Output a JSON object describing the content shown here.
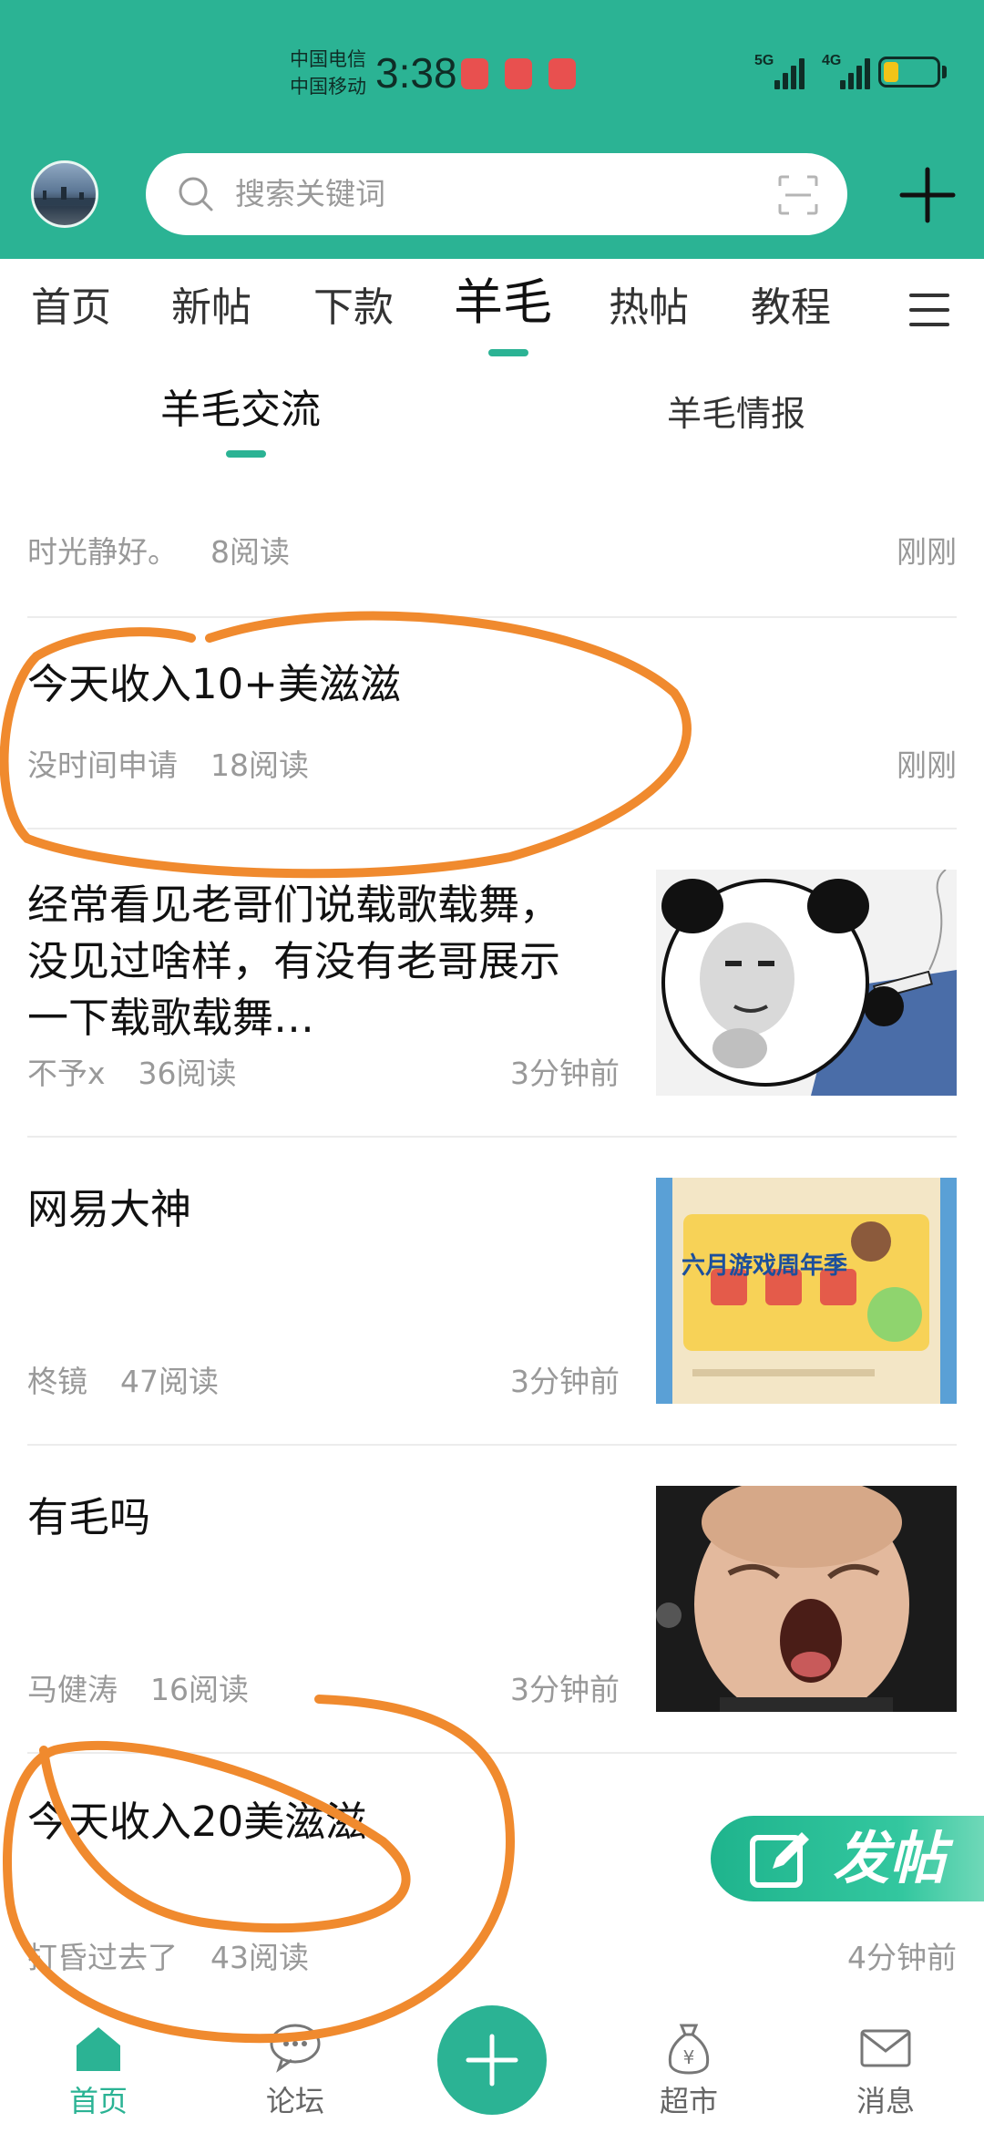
{
  "status_bar": {
    "carrier1": "中国电信",
    "carrier2": "中国移动",
    "time": "3:38",
    "net1": "5G",
    "net2": "4G"
  },
  "header": {
    "search_placeholder": "搜索关键词"
  },
  "tabs": [
    {
      "label": "首页"
    },
    {
      "label": "新帖"
    },
    {
      "label": "下款"
    },
    {
      "label": "羊毛",
      "active": true
    },
    {
      "label": "热帖"
    },
    {
      "label": "教程"
    }
  ],
  "subtabs": [
    {
      "label": "羊毛交流",
      "active": true
    },
    {
      "label": "羊毛情报"
    }
  ],
  "posts": [
    {
      "title": "",
      "author": "时光静好。",
      "reads": "8阅读",
      "time": "刚刚"
    },
    {
      "title": "今天收入10+美滋滋",
      "author": "没时间申请",
      "reads": "18阅读",
      "time": "刚刚"
    },
    {
      "title_line1": "经常看见老哥们说载歌载舞，",
      "title_line2": "没见过啥样，有没有老哥展示",
      "title_line3": "一下载歌载舞…",
      "author": "不予x",
      "reads": "36阅读",
      "time": "3分钟前",
      "thumb": "panda-meme-thumbnail"
    },
    {
      "title": "网易大神",
      "author": "柊镜",
      "reads": "47阅读",
      "time": "3分钟前",
      "thumb": "game-anniversary-thumbnail",
      "thumb_text": "六月游戏周年季"
    },
    {
      "title": "有毛吗",
      "author": "马健涛",
      "reads": "16阅读",
      "time": "3分钟前",
      "thumb": "screaming-man-thumbnail"
    },
    {
      "title": "今天收入20美滋滋",
      "author": "打昏过去了",
      "reads": "43阅读",
      "time": "4分钟前"
    }
  ],
  "fab": {
    "label": "发帖"
  },
  "bottom_nav": [
    {
      "label": "首页",
      "icon": "home-icon",
      "active": true
    },
    {
      "label": "论坛",
      "icon": "chat-bubble-icon"
    },
    {
      "label": "",
      "icon": "plus-icon"
    },
    {
      "label": "超市",
      "icon": "money-bag-icon"
    },
    {
      "label": "消息",
      "icon": "envelope-icon"
    }
  ],
  "colors": {
    "accent": "#2bb394",
    "annotation": "#f08a2e",
    "meta_text": "#999999"
  }
}
